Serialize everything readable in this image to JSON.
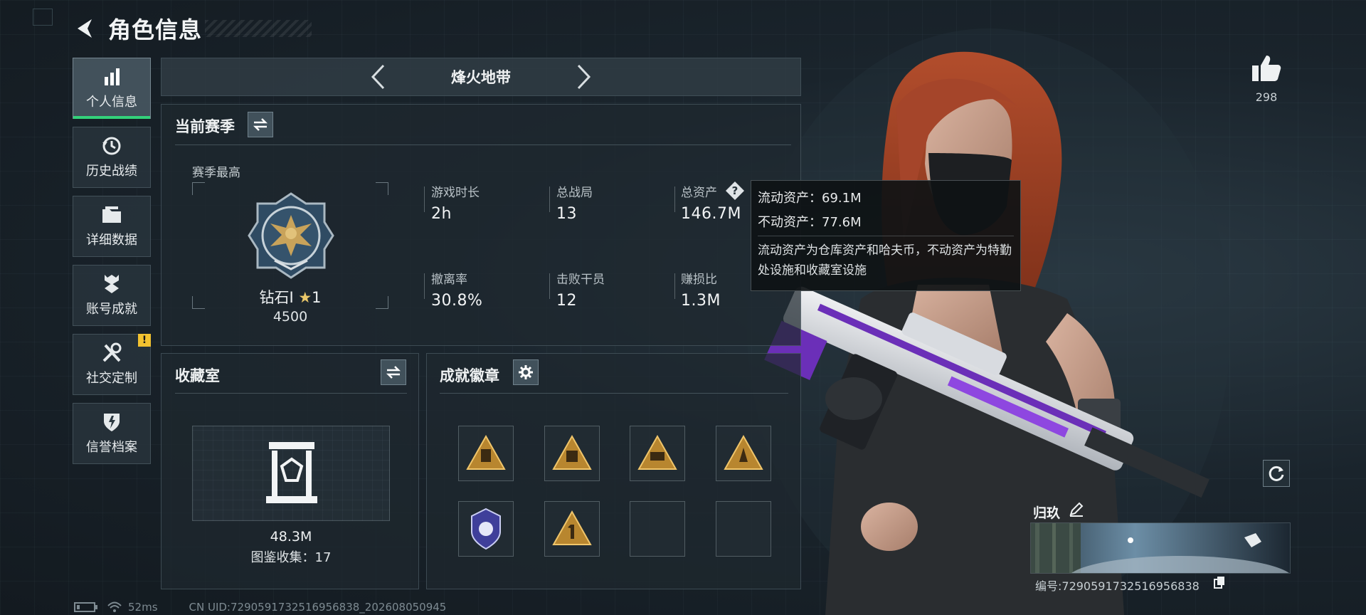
{
  "header": {
    "title": "角色信息"
  },
  "sidebar": {
    "items": [
      {
        "label": "个人信息",
        "icon": "bar-chart-icon",
        "active": true
      },
      {
        "label": "历史战绩",
        "icon": "history-clock-icon"
      },
      {
        "label": "详细数据",
        "icon": "folder-icon"
      },
      {
        "label": "账号成就",
        "icon": "achievement-icon"
      },
      {
        "label": "社交定制",
        "icon": "tools-icon",
        "alert": "!"
      },
      {
        "label": "信誉档案",
        "icon": "shield-icon"
      }
    ]
  },
  "mode": {
    "title": "烽火地带"
  },
  "season": {
    "title": "当前赛季",
    "best_label": "赛季最高",
    "rank_name": "钻石Ⅰ",
    "rank_star": "★",
    "rank_stars": "1",
    "rank_score": "4500",
    "stats": [
      {
        "label": "游戏时长",
        "value": "2h"
      },
      {
        "label": "总战局",
        "value": "13"
      },
      {
        "label": "总资产",
        "value": "146.7M"
      },
      {
        "label": "撤离率",
        "value": "30.8%"
      },
      {
        "label": "击败干员",
        "value": "12"
      },
      {
        "label": "赚损比",
        "value": "1.3M"
      }
    ]
  },
  "tooltip": {
    "liquid": "流动资产：69.1M",
    "fixed": "不动资产：77.6M",
    "desc": "流动资产为仓库资产和哈夫币，不动资产为特勤处设施和收藏室设施"
  },
  "collection": {
    "title": "收藏室",
    "value": "48.3M",
    "count_text": "图鉴收集：17"
  },
  "achievements": {
    "title": "成就徽章"
  },
  "profile": {
    "likes": "298",
    "name": "归玖",
    "id_text": "编号:7290591732516956838"
  },
  "status": {
    "ping": "52ms",
    "uid": "CN UID:7290591732516956838_202608050945"
  },
  "colors": {
    "accent": "#33d17a",
    "alert": "#f2c230",
    "panel": "#1e282f"
  }
}
